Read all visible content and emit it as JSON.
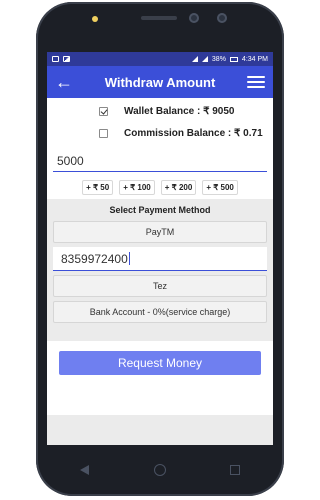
{
  "status_bar": {
    "battery": "38%",
    "time": "4:34 PM"
  },
  "app_bar": {
    "title": "Withdraw Amount",
    "back_icon": "arrow-left-icon",
    "menu_icon": "hamburger-menu-icon"
  },
  "balances": [
    {
      "label": "Wallet Balance : ₹ 9050",
      "checked": true
    },
    {
      "label": "Commission Balance : ₹ 0.71",
      "checked": false
    }
  ],
  "amount_input": {
    "value": "5000"
  },
  "quick_add": [
    "+ ₹ 50",
    "+ ₹ 100",
    "+ ₹ 200",
    "+ ₹ 500"
  ],
  "payment": {
    "title": "Select Payment Method",
    "methods": {
      "paytm": "PayTM",
      "tez": "Tez",
      "bank": "Bank Account - 0%(service charge)"
    },
    "phone_value": "8359972400"
  },
  "cta": {
    "label": "Request Money",
    "color": "#6f7ff0"
  },
  "colors": {
    "primary": "#3b4fd8",
    "status_bar": "#2f3a99"
  }
}
